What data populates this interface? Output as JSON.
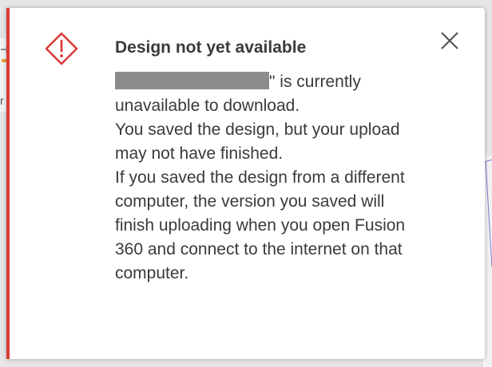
{
  "notification": {
    "title": "Design not yet available",
    "message_first_suffix": "\" is currently unavailable to download.",
    "message_lines": [
      "You saved the design, but your upload may not have finished.",
      "If you saved the design from a different computer, the version you saved will finish uploading when you open Fusion 360 and connect to the internet on that computer."
    ],
    "icon": "warning-diamond-icon",
    "close_icon": "close-icon",
    "accent_color": "#d93a35"
  }
}
